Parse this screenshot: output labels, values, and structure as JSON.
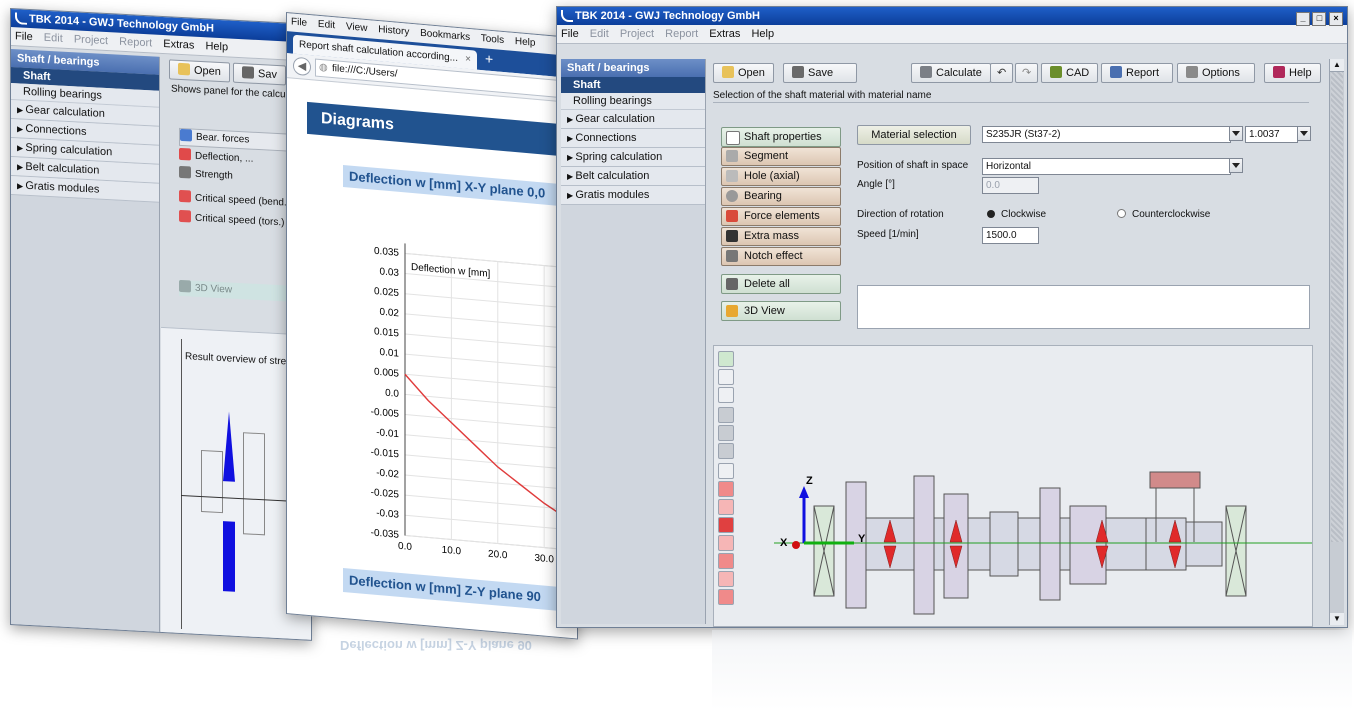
{
  "back_window": {
    "title": "TBK 2014 - GWJ Technology GmbH",
    "menu": [
      "File",
      "Edit",
      "Project",
      "Report",
      "Extras",
      "Help"
    ],
    "sidebar_header": "Shaft / bearings",
    "sidebar_selected": "Shaft",
    "sidebar_sub": "Rolling bearings",
    "sidebar_groups": [
      "Gear calculation",
      "Connections",
      "Spring calculation",
      "Belt calculation",
      "Gratis modules"
    ],
    "open_label": "Open",
    "save_label": "Sav",
    "status": "Shows panel for the calcula",
    "bear_forces": "Bear. forces",
    "deflection": "Deflection, ...",
    "strength": "Strength",
    "critical_bend": "Critical speed (bend.",
    "critical_tors": "Critical speed (tors.)",
    "view3d": "3D View",
    "result_overview": "Result overview of stren"
  },
  "browser": {
    "menu": [
      "File",
      "Edit",
      "View",
      "History",
      "Bookmarks",
      "Tools",
      "Help"
    ],
    "tab_title": "Report shaft calculation according...",
    "tab_close": "×",
    "new_tab": "+",
    "url": "file:///C:/Users/",
    "diagrams_heading": "Diagrams",
    "chart_heading": "Deflection w [mm] X-Y plane 0,0",
    "chart_heading2": "Deflection w [mm] Z-Y plane 90",
    "reflection": "Deflection w [mm] Z-Y plane 90"
  },
  "chart_data": {
    "type": "line",
    "ylabel": "Deflection w [mm]",
    "yticks": [
      "0.035",
      "0.03",
      "0.025",
      "0.02",
      "0.015",
      "0.01",
      "0.005",
      "0.0",
      "-0.005",
      "-0.01",
      "-0.015",
      "-0.02",
      "-0.025",
      "-0.03",
      "-0.035"
    ],
    "xticks": [
      "0.0",
      "10.0",
      "20.0",
      "30.0"
    ],
    "ylim": [
      -0.035,
      0.035
    ],
    "xlim": [
      0,
      36
    ],
    "grid": true,
    "series": [
      {
        "color": "#e03c3c",
        "x": [
          0,
          5,
          10,
          15,
          20,
          25,
          30,
          36
        ],
        "y": [
          0.005,
          -0.001,
          -0.006,
          -0.011,
          -0.016,
          -0.02,
          -0.024,
          -0.028
        ]
      }
    ]
  },
  "front_window": {
    "title": "TBK 2014 - GWJ Technology GmbH",
    "menu": [
      {
        "label": "File",
        "enabled": true
      },
      {
        "label": "Edit",
        "enabled": false
      },
      {
        "label": "Project",
        "enabled": false
      },
      {
        "label": "Report",
        "enabled": false
      },
      {
        "label": "Extras",
        "enabled": true
      },
      {
        "label": "Help",
        "enabled": true
      }
    ],
    "window_controls": [
      "_",
      "□",
      "×"
    ],
    "sidebar_header": "Shaft / bearings",
    "sidebar_selected": "Shaft",
    "sidebar_sub": "Rolling bearings",
    "sidebar_groups": [
      "Gear calculation",
      "Connections",
      "Spring calculation",
      "Belt calculation",
      "Gratis modules"
    ],
    "toolbar": {
      "open": "Open",
      "save": "Save",
      "calculate": "Calculate",
      "cad": "CAD",
      "report": "Report",
      "options": "Options",
      "help": "Help"
    },
    "status": "Selection of the shaft material with material name",
    "left_buttons": [
      "Shaft properties",
      "Segment",
      "Hole (axial)",
      "Bearing",
      "Force elements",
      "Extra mass",
      "Notch effect"
    ],
    "delete_all": "Delete all",
    "view3d": "3D View",
    "material_button": "Material selection",
    "material_value": "S235JR (St37-2)",
    "material_number": "1.0037",
    "position_label": "Position of shaft in space",
    "position_value": "Horizontal",
    "angle_label": "Angle [°]",
    "angle_value": "0.0",
    "rotation_label": "Direction of rotation",
    "clockwise": "Clockwise",
    "counterclockwise": "Counterclockwise",
    "speed_label": "Speed [1/min]",
    "speed_value": "1500.0",
    "axis_z": "Z",
    "axis_x": "X",
    "axis_y": "Y"
  }
}
